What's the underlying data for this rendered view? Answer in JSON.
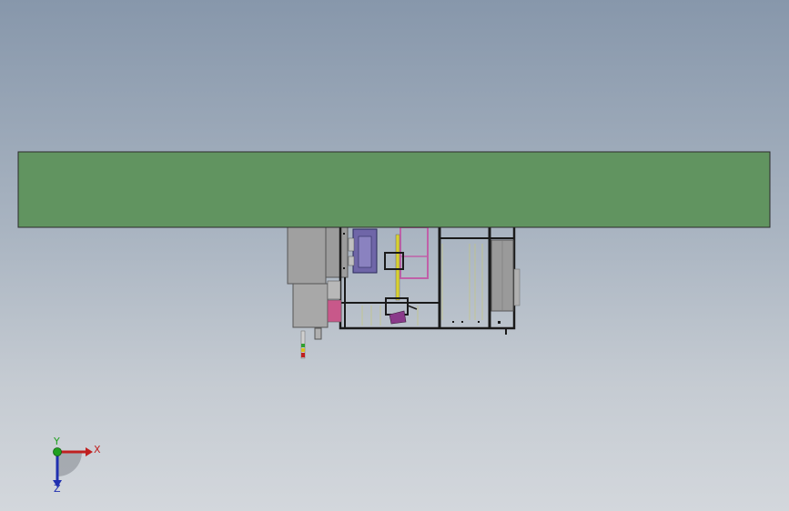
{
  "viewport": {
    "background_top": "#8797ab",
    "background_bottom": "#d3d7dc"
  },
  "model": {
    "plate_color": "#619460",
    "frame_color": "#1a1a1a",
    "panel_gray": "#9a9a9a",
    "panel_purple": "#6f66a8",
    "accent_magenta": "#c060a8",
    "accent_purple": "#8a3a8a",
    "accent_yellow": "#d8d030"
  },
  "triad": {
    "x_label": "X",
    "y_label": "Y",
    "z_label": "Z",
    "x_color": "#c02020",
    "y_color": "#20a020",
    "z_color": "#2030b0"
  }
}
